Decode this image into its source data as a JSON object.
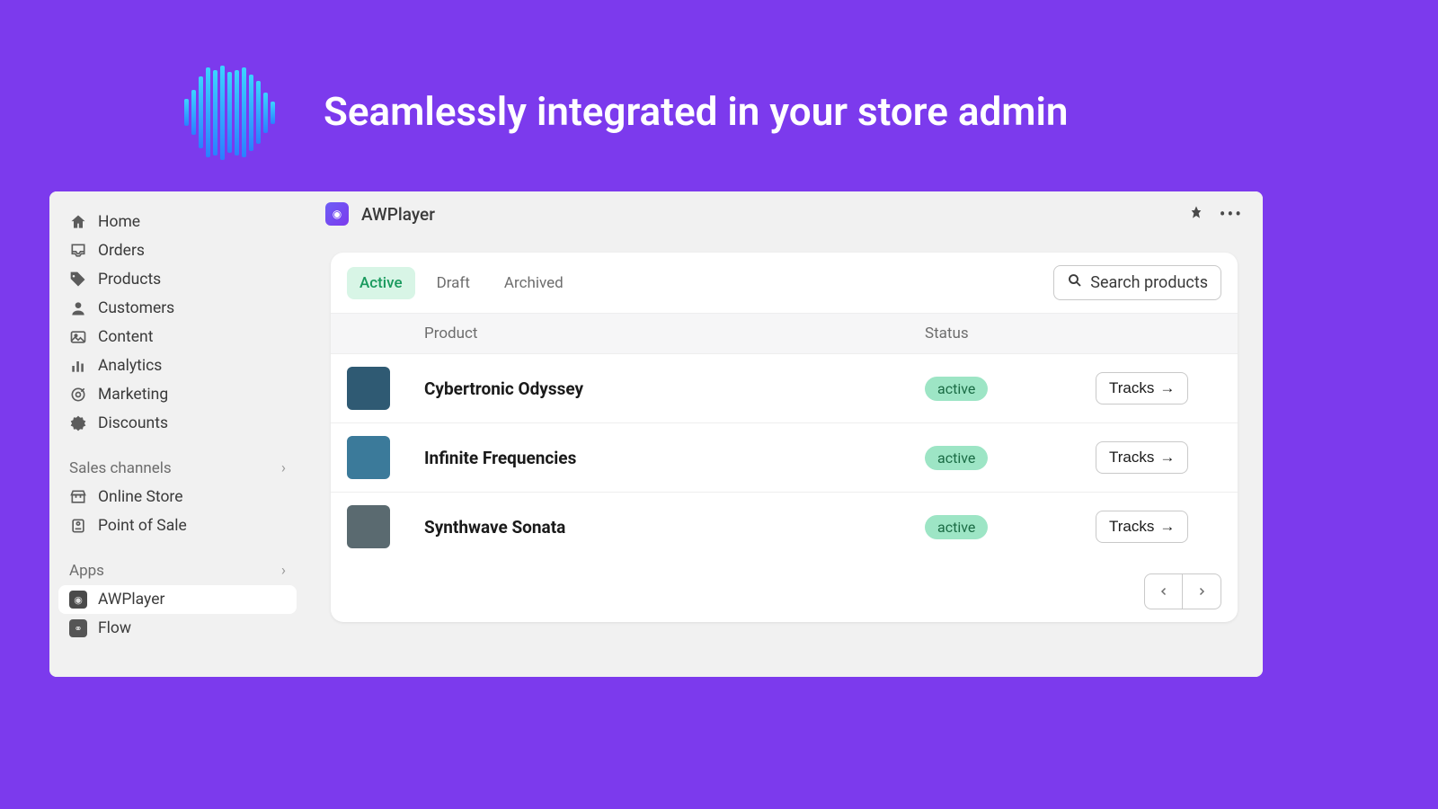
{
  "hero": {
    "title": "Seamlessly integrated in your store admin"
  },
  "sidebar": {
    "nav": [
      {
        "icon": "home",
        "label": "Home"
      },
      {
        "icon": "inbox",
        "label": "Orders"
      },
      {
        "icon": "tag",
        "label": "Products"
      },
      {
        "icon": "person",
        "label": "Customers"
      },
      {
        "icon": "image",
        "label": "Content"
      },
      {
        "icon": "bars",
        "label": "Analytics"
      },
      {
        "icon": "target",
        "label": "Marketing"
      },
      {
        "icon": "badge",
        "label": "Discounts"
      }
    ],
    "sales_header": "Sales channels",
    "sales": [
      {
        "icon": "store",
        "label": "Online Store"
      },
      {
        "icon": "pos",
        "label": "Point of Sale"
      }
    ],
    "apps_header": "Apps",
    "apps": [
      {
        "icon": "awplayer",
        "label": "AWPlayer",
        "selected": true
      },
      {
        "icon": "flow",
        "label": "Flow"
      }
    ]
  },
  "appbar": {
    "title": "AWPlayer"
  },
  "tabs": [
    {
      "label": "Active",
      "active": true
    },
    {
      "label": "Draft"
    },
    {
      "label": "Archived"
    }
  ],
  "search_label": "Search products",
  "table": {
    "headers": {
      "product": "Product",
      "status": "Status"
    },
    "rows": [
      {
        "name": "Cybertronic Odyssey",
        "status": "active",
        "thumb": "#2f5a73"
      },
      {
        "name": "Infinite Frequencies",
        "status": "active",
        "thumb": "#3b7a9a"
      },
      {
        "name": "Synthwave Sonata",
        "status": "active",
        "thumb": "#5a6a70"
      }
    ],
    "action_label": "Tracks"
  }
}
